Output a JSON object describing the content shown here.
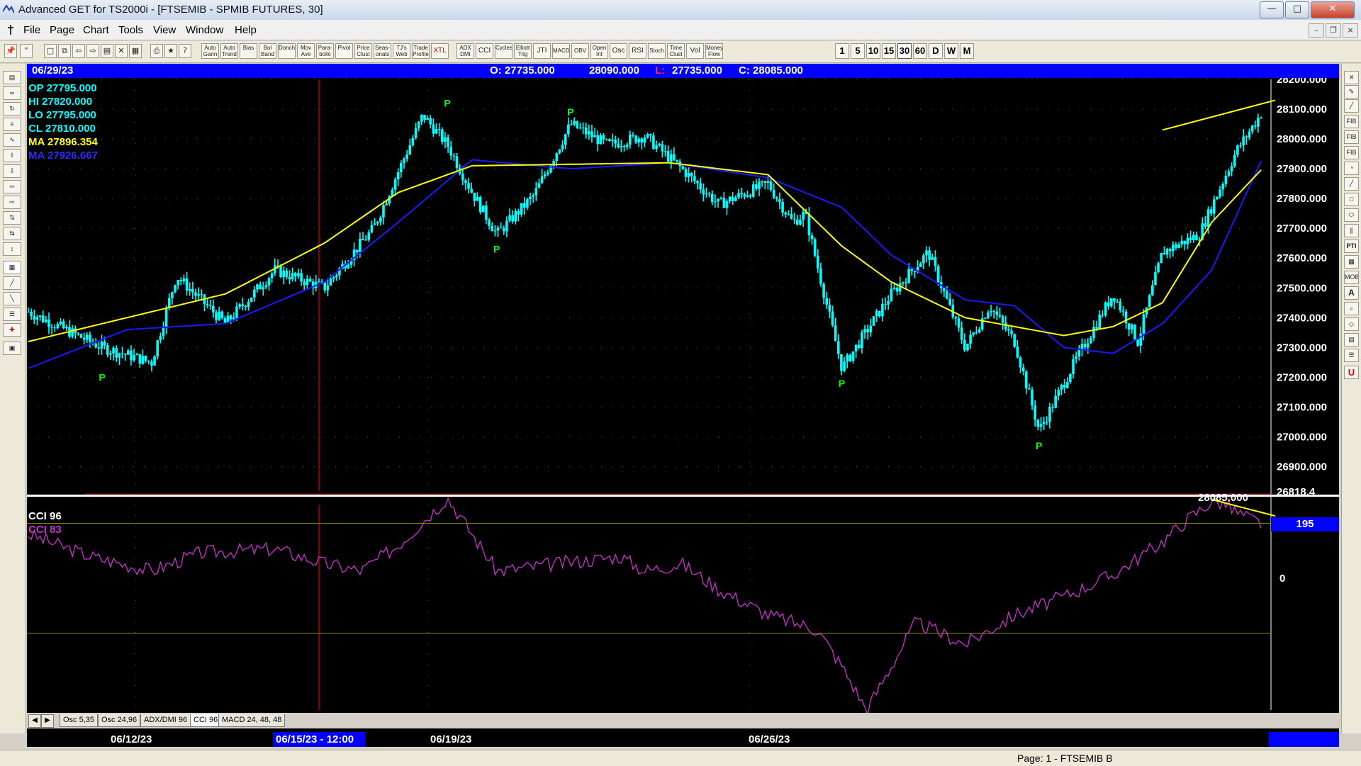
{
  "window": {
    "title": "Advanced GET for TS2000i - [FTSEMIB - SPMIB FUTURES, 30]",
    "minimize": "—",
    "maximize": "□",
    "close": "✕"
  },
  "menu": {
    "items": [
      "File",
      "Page",
      "Chart",
      "Tools",
      "View",
      "Window",
      "Help"
    ],
    "mdi": {
      "min": "–",
      "restore": "❐",
      "close": "×"
    }
  },
  "toolbar": {
    "studies": [
      "Auto Gann",
      "Auto Trend",
      "Bias",
      "Bol Band",
      "Donch",
      "Mov Ave",
      "Para-bolic",
      "Pivot",
      "Price Clust",
      "Seas-onals",
      "TJ's Web",
      "Trade Profile",
      "XTL",
      "ADX DMI",
      "CCI",
      "Cycles",
      "Elliott Trig",
      "JTI",
      "MACD",
      "OBV",
      "Open Int",
      "Osc",
      "RSI",
      "Stoch",
      "Time Clust",
      "Vol",
      "Money Flow"
    ],
    "timeframes": [
      "1",
      "5",
      "10",
      "15",
      "30",
      "60",
      "D",
      "W",
      "M"
    ],
    "active_timeframe": "30"
  },
  "chart": {
    "header": {
      "date": "06/29/23",
      "open": "O: 27735.000",
      "high": "28090.000",
      "low_label": "L:",
      "low_value": "27735.000",
      "close": "C: 28085.000"
    },
    "readout": {
      "op": "OP  27795.000",
      "hi": "HI   27820.000",
      "lo": "LO  27795.000",
      "cl": "CL  27810.000",
      "ma1": "MA  27896.354",
      "ma2": "MA  27926.667"
    },
    "price_tag": "28085.000",
    "colors": {
      "background": "#000000",
      "candle": "#00ffff",
      "ma_fast": "#ffff00",
      "ma_slow": "#1a1aff",
      "pivot": "#00ff00",
      "cci": "#cc33cc",
      "grid": "#555555"
    },
    "pivot_label": "P"
  },
  "chart_data": {
    "type": "line",
    "title": "FTSEMIB - SPMIB FUTURES, 30",
    "y_axis": {
      "ticks": [
        "28200.000",
        "28100.000",
        "28000.000",
        "27900.000",
        "27800.000",
        "27700.000",
        "27600.000",
        "27500.000",
        "27400.000",
        "27300.000",
        "27200.000",
        "27100.000",
        "27000.000",
        "26900.000"
      ],
      "partial_bottom": "26818.4",
      "ylim": [
        26818,
        28200
      ]
    },
    "x_axis": {
      "labels": [
        "06/12/23",
        "06/15/23 - 12:00",
        "06/19/23",
        "06/26/23"
      ]
    },
    "series": [
      {
        "name": "Price",
        "x": [
          0,
          6,
          10,
          12,
          16,
          20,
          24,
          28,
          32,
          34,
          36,
          38,
          41,
          44,
          47,
          50,
          53,
          56,
          60,
          62,
          63,
          66,
          70,
          73,
          76,
          78,
          80,
          82,
          85,
          88,
          90,
          92,
          95,
          98,
          100
        ],
        "y": [
          27420,
          27300,
          27250,
          27540,
          27380,
          27560,
          27500,
          27700,
          28080,
          27980,
          27820,
          27680,
          27810,
          28050,
          27980,
          28010,
          27900,
          27780,
          27850,
          27720,
          27750,
          27230,
          27480,
          27620,
          27300,
          27440,
          27320,
          27020,
          27260,
          27480,
          27320,
          27620,
          27680,
          27960,
          28085
        ]
      },
      {
        "name": "MA",
        "x": [
          0,
          8,
          16,
          24,
          30,
          36,
          44,
          52,
          60,
          66,
          70,
          76,
          80,
          84,
          88,
          92,
          96,
          100
        ],
        "y": [
          27320,
          27400,
          27480,
          27650,
          27820,
          27910,
          27915,
          27920,
          27880,
          27640,
          27520,
          27400,
          27370,
          27340,
          27370,
          27450,
          27720,
          27896
        ]
      },
      {
        "name": "MA",
        "x": [
          0,
          8,
          16,
          24,
          30,
          36,
          44,
          52,
          60,
          66,
          70,
          76,
          80,
          84,
          88,
          92,
          96,
          100
        ],
        "y": [
          27230,
          27360,
          27380,
          27520,
          27720,
          27930,
          27900,
          27920,
          27870,
          27770,
          27610,
          27460,
          27440,
          27300,
          27280,
          27380,
          27560,
          27926
        ]
      }
    ],
    "pivots": [
      {
        "type": "low",
        "x": 6,
        "y": 27250
      },
      {
        "type": "high",
        "x": 34,
        "y": 28080
      },
      {
        "type": "low",
        "x": 38,
        "y": 27680
      },
      {
        "type": "high",
        "x": 44,
        "y": 28050
      },
      {
        "type": "low",
        "x": 66,
        "y": 27230
      },
      {
        "type": "low",
        "x": 82,
        "y": 27020
      }
    ],
    "trendline": {
      "x": [
        92,
        100
      ],
      "y": [
        28030,
        28130
      ]
    },
    "indicator": {
      "name": "CCI 96",
      "series_name": "CCI  83",
      "value": "195",
      "zero_label": "0",
      "x": [
        0,
        5,
        10,
        14,
        20,
        24,
        27,
        30,
        34,
        38,
        43,
        48,
        50,
        53,
        56,
        60,
        64,
        66,
        68,
        72,
        76,
        80,
        84,
        88,
        92,
        94,
        96,
        97,
        98,
        100
      ],
      "y": [
        120,
        60,
        20,
        70,
        80,
        40,
        20,
        90,
        220,
        20,
        40,
        60,
        20,
        40,
        -30,
        -100,
        -140,
        -240,
        -360,
        -120,
        -180,
        -100,
        -50,
        10,
        100,
        160,
        210,
        205,
        180,
        150
      ]
    },
    "indicator_trendline": {
      "x": [
        96,
        100
      ],
      "y": [
        215,
        170
      ]
    }
  },
  "tabs": [
    "Osc 5,35",
    "Osc 24,96",
    "ADX/DMI 96",
    "CCI 96",
    "MACD 24, 48, 48"
  ],
  "active_tab": "CCI 96",
  "status": {
    "page": "Page: 1 - FTSEMIB B"
  }
}
